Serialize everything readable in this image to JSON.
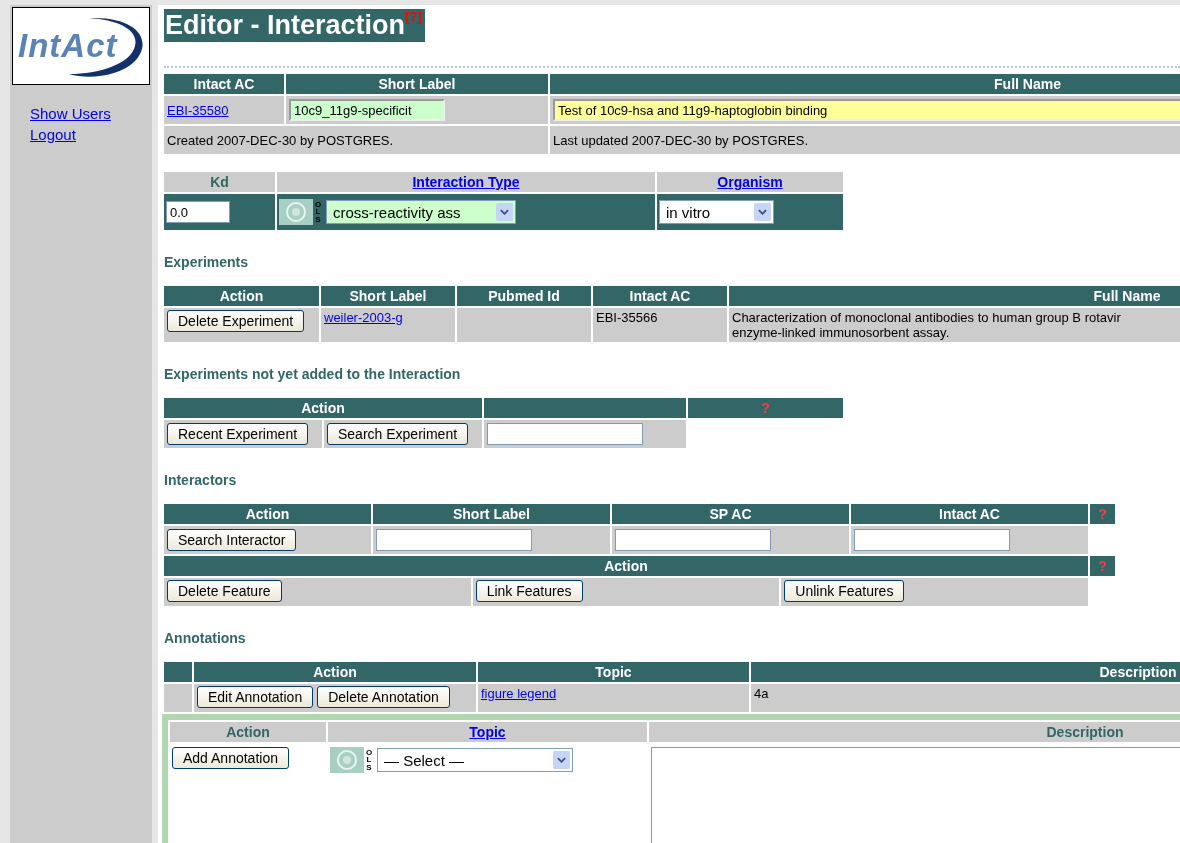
{
  "sidebar": {
    "logo": "IntAct",
    "links": [
      {
        "label": "Show Users"
      },
      {
        "label": "Logout"
      }
    ]
  },
  "title": {
    "text": "Editor - Interaction",
    "help": "[?]"
  },
  "interaction": {
    "columns": [
      "Intact AC",
      "Short Label",
      "Full Name"
    ],
    "ac": "EBI-35580",
    "short_label": "10c9_11g9-specificit",
    "full_name": "Test of 10c9-hsa and 11g9-haptoglobin binding",
    "created": "Created 2007-DEC-30 by POSTGRES.",
    "updated": "Last updated 2007-DEC-30 by POSTGRES."
  },
  "properties": {
    "columns": [
      {
        "label": "Kd",
        "link": false
      },
      {
        "label": "Interaction Type",
        "link": true
      },
      {
        "label": "Organism",
        "link": true
      }
    ],
    "kd": "0.0",
    "ols_label": "OLS",
    "interaction_type": "cross-reactivity ass",
    "organism": "in vitro"
  },
  "experiments": {
    "heading": "Experiments",
    "columns": [
      "Action",
      "Short Label",
      "Pubmed Id",
      "Intact AC",
      "Full Name"
    ],
    "rows": [
      {
        "action": "Delete Experiment",
        "short_label": "weiler-2003-g",
        "ac": "EBI-35566",
        "full_name_lines": [
          "Characterization of monoclonal antibodies to human group B rotavir",
          "enzyme-linked immunosorbent assay."
        ]
      }
    ]
  },
  "pending_experiments": {
    "heading": "Experiments not yet added to the Interaction",
    "action_header": "Action",
    "help": "?",
    "buttons": [
      "Recent Experiment",
      "Search Experiment"
    ]
  },
  "interactors": {
    "heading": "Interactors",
    "columns": [
      "Action",
      "Short Label",
      "SP AC",
      "Intact AC"
    ],
    "help": "?",
    "search_button": "Search Interactor",
    "feature_header": "Action",
    "feature_help": "?",
    "feature_buttons": [
      "Delete Feature",
      "Link Features",
      "Unlink Features"
    ]
  },
  "annotations": {
    "heading": "Annotations",
    "columns": [
      "Action",
      "Topic",
      "Description"
    ],
    "rows": [
      {
        "buttons": [
          "Edit Annotation",
          "Delete Annotation"
        ],
        "topic": "figure legend",
        "description": "4a"
      }
    ],
    "new": {
      "columns": [
        {
          "label": "Action",
          "link": false
        },
        {
          "label": "Topic",
          "link": true
        },
        {
          "label": "Description",
          "link": false
        }
      ],
      "button": "Add Annotation",
      "ols_label": "OLS",
      "topic_select": "— Select —"
    }
  }
}
